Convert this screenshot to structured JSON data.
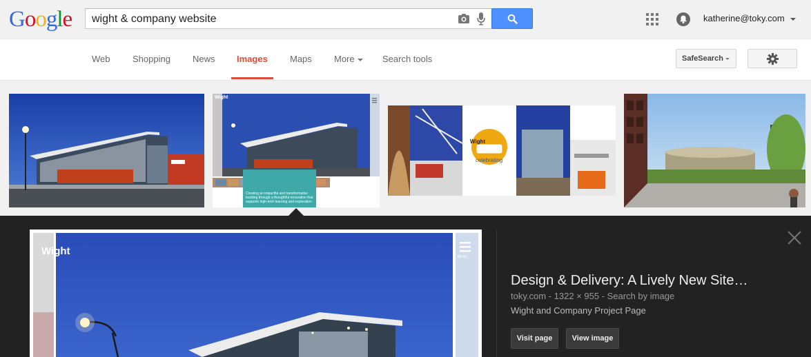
{
  "logo": {
    "letters": [
      "G",
      "o",
      "o",
      "g",
      "l",
      "e"
    ],
    "colors": [
      "#3369e8",
      "#d50f25",
      "#eeb211",
      "#3369e8",
      "#009925",
      "#d50f25"
    ]
  },
  "search": {
    "query": "wight & company website",
    "button_color": "#4d90fe"
  },
  "account": {
    "email": "katherine@toky.com"
  },
  "nav": {
    "tabs": [
      {
        "label": "Web"
      },
      {
        "label": "Shopping"
      },
      {
        "label": "News"
      },
      {
        "label": "Images"
      },
      {
        "label": "Maps"
      },
      {
        "label": "More"
      },
      {
        "label": "Search tools"
      }
    ],
    "active_tab": "Images",
    "active_color": "#dd4b39",
    "safesearch_label": "SafeSearch"
  },
  "thumbnails": {
    "thumb2_logo": "Wight",
    "thumb2_caption": "Creating an impactful and transformative building through a thoughtful renovation that supports high-tech learning and exploration",
    "thumb3_logo": "Wight",
    "thumb3_badge": "celebrating"
  },
  "preview": {
    "logo": "Wight",
    "menu_label": "MENU",
    "title": "Design & Delivery: A Lively New Site…",
    "source": "toky.com",
    "dimensions": "1322 × 955",
    "separator": " - ",
    "search_by_image": "Search by image",
    "description": "Wight and Company Project Page",
    "visit_label": "Visit page",
    "view_label": "View image"
  }
}
